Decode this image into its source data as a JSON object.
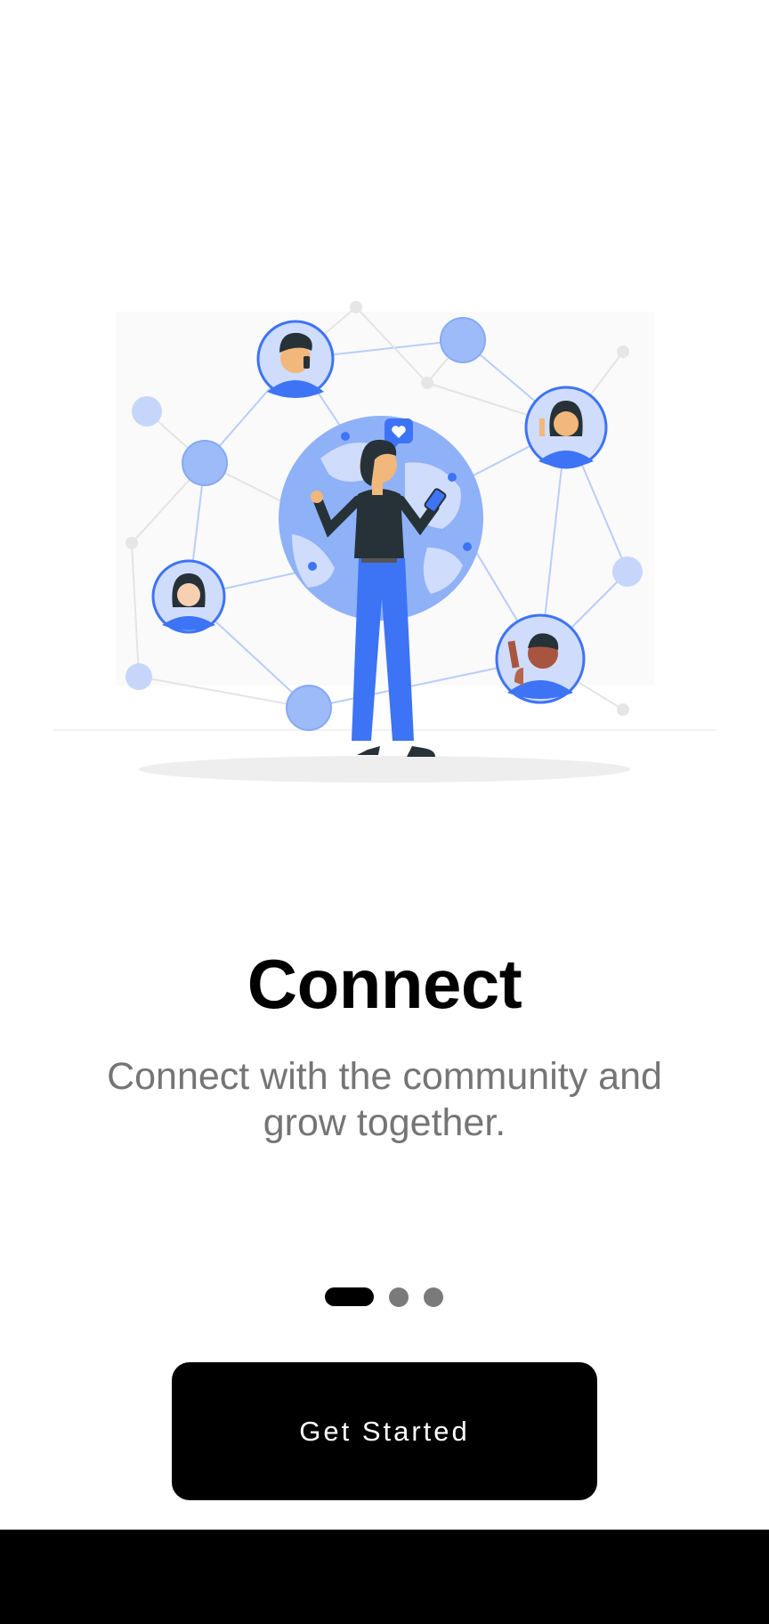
{
  "onboarding": {
    "title": "Connect",
    "subtitle": "Connect with the community and grow together.",
    "page_indicator": {
      "total": 3,
      "active": 1
    },
    "cta_label": "Get Started"
  },
  "colors": {
    "accent_blue": "#3d74f5",
    "light_blue": "#8fb1f8",
    "text_primary": "#000000",
    "text_secondary": "#757575",
    "button_bg": "#000000"
  }
}
